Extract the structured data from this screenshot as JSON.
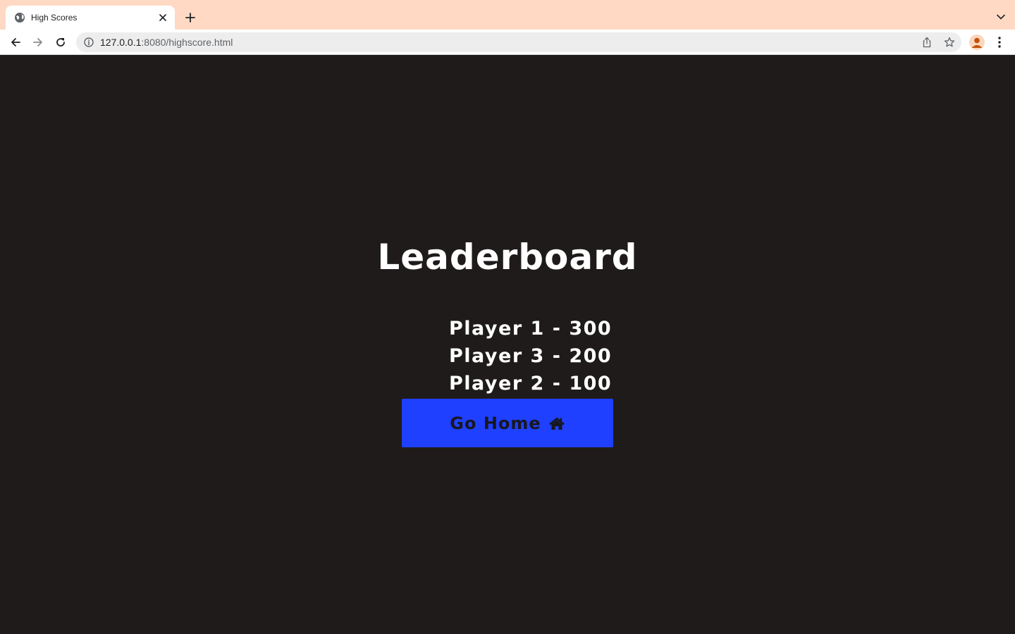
{
  "browser": {
    "tab_title": "High Scores",
    "url_host": "127.0.0.1",
    "url_rest": ":8080/highscore.html",
    "accent_tabstrip": "#ffd9c4"
  },
  "page": {
    "heading": "Leaderboard",
    "scores": [
      "Player 1 - 300",
      "Player 3 - 200",
      "Player 2 - 100"
    ],
    "home_button_label": "Go Home",
    "home_button_icon": "home-icon",
    "colors": {
      "background": "#1f1b1a",
      "text": "#ffffff",
      "button": "#1f40ff"
    }
  }
}
